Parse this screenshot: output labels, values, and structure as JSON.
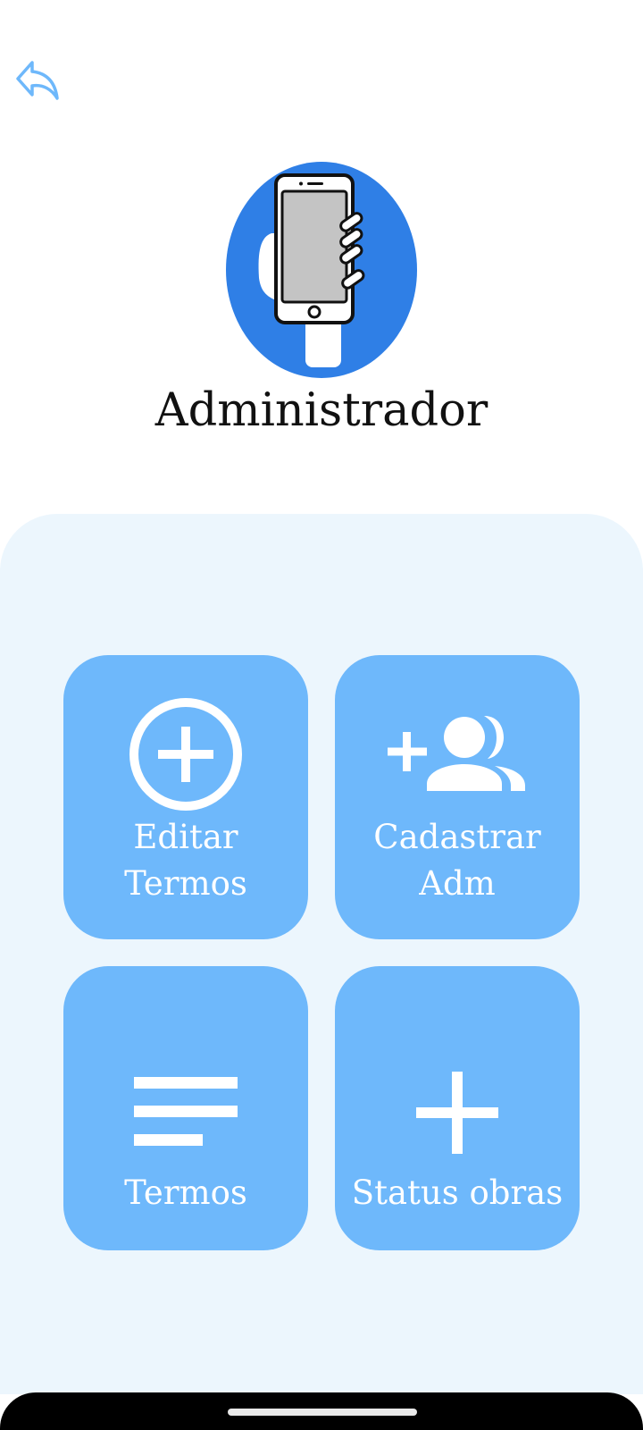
{
  "header": {
    "back_icon": "reply-arrow-icon"
  },
  "profile": {
    "avatar_icon": "hand-holding-phone-icon",
    "title": "Administrador"
  },
  "menu": {
    "tiles": [
      {
        "id": "edit-terms",
        "icon": "add-circle-outline-icon",
        "label": "Editar\nTermos"
      },
      {
        "id": "register-admin",
        "icon": "group-add-icon",
        "label": "Cadastrar\nAdm"
      },
      {
        "id": "terms",
        "icon": "short-text-lines-icon",
        "label": "Termos"
      },
      {
        "id": "status-works",
        "icon": "plus-icon",
        "label": "Status obras"
      }
    ]
  },
  "colors": {
    "tile_bg": "#6eb8fb",
    "panel_bg": "#ecf6fd",
    "avatar_circle": "#2f7fe6",
    "back_icon": "#6eb8fb",
    "title_text": "#111111"
  }
}
